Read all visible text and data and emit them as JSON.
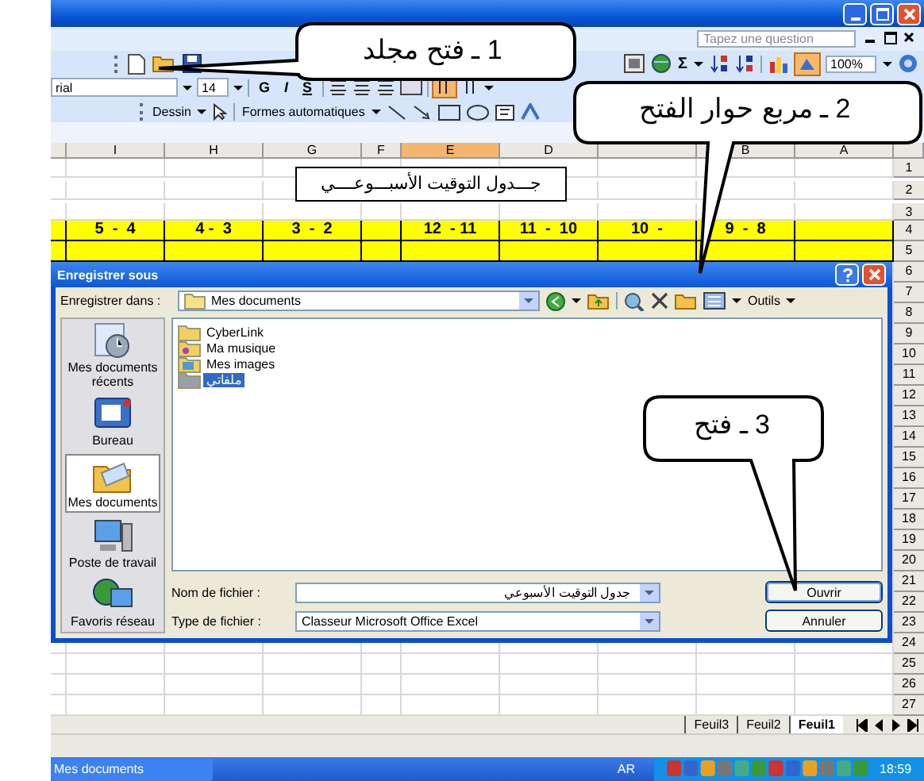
{
  "help_search": {
    "placeholder": "Tapez une question"
  },
  "standard_toolbar": {
    "sum": "Σ",
    "zoom": "100%"
  },
  "format_toolbar": {
    "font": "rial",
    "size": "14",
    "styles": [
      "G",
      "I",
      "S"
    ]
  },
  "drawing_toolbar": {
    "draw_menu": "Dessin",
    "shapes_menu": "Formes automatiques"
  },
  "sheet": {
    "columns": [
      {
        "label": "I",
        "selected": false
      },
      {
        "label": "H",
        "selected": false
      },
      {
        "label": "G",
        "selected": false
      },
      {
        "label": "F",
        "selected": false
      },
      {
        "label": "E",
        "selected": true
      },
      {
        "label": "D",
        "selected": false
      },
      {
        "label": "B",
        "selected": false
      },
      {
        "label": "A",
        "selected": false
      }
    ],
    "title_cell": "جـــدول التوقيت الأسبـــوعــــي",
    "time_row": [
      "5  -  4",
      "4 -  3",
      "3  -  2",
      "12  - 11",
      "11  -  10",
      "10  -",
      "9  -  8"
    ],
    "row_numbers": [
      "1",
      "2",
      "3",
      "4",
      "5",
      "6",
      "7",
      "8",
      "9",
      "10",
      "11",
      "12",
      "13",
      "14",
      "15",
      "16",
      "17",
      "18",
      "19",
      "20",
      "21",
      "22",
      "23",
      "24",
      "25",
      "26",
      "27"
    ]
  },
  "sheet_tabs": [
    {
      "label": "Feuil3",
      "selected": false
    },
    {
      "label": "Feuil2",
      "selected": false
    },
    {
      "label": "Feuil1",
      "selected": true
    }
  ],
  "dialog": {
    "title": "Enregistrer sous",
    "save_in_label": "Enregistrer dans :",
    "location": "Mes documents",
    "tools": "Outils",
    "places": [
      {
        "label": "Mes documents récents",
        "kind": "recent",
        "selected": false
      },
      {
        "label": "Bureau",
        "kind": "desktop",
        "selected": false
      },
      {
        "label": "Mes documents",
        "kind": "documents",
        "selected": true
      },
      {
        "label": "Poste de travail",
        "kind": "computer",
        "selected": false
      },
      {
        "label": "Favoris réseau",
        "kind": "network",
        "selected": false
      }
    ],
    "files": [
      {
        "name": "CyberLink",
        "kind": "folder",
        "selected": false
      },
      {
        "name": "Ma musique",
        "kind": "music",
        "selected": false
      },
      {
        "name": "Mes images",
        "kind": "pictures",
        "selected": false
      },
      {
        "name": "ملفاتي",
        "kind": "folder",
        "selected": true
      }
    ],
    "filename_label": "Nom de fichier :",
    "filename": "جدول التوقيت الأسبوعي",
    "filetype_label": "Type de fichier :",
    "filetype": "Classeur Microsoft Office Excel",
    "buttons": [
      {
        "label": "Ouvrir",
        "kind": "default"
      },
      {
        "label": "Annuler",
        "kind": "normal"
      }
    ]
  },
  "callouts": [
    {
      "text": "1 ـ فتح مجلد"
    },
    {
      "text": "2 ـ مربع حوار الفتح"
    },
    {
      "text": "3 ـ فتح"
    }
  ],
  "taskbar": {
    "task": "Mes documents",
    "language": "AR",
    "clock": "18:59"
  }
}
